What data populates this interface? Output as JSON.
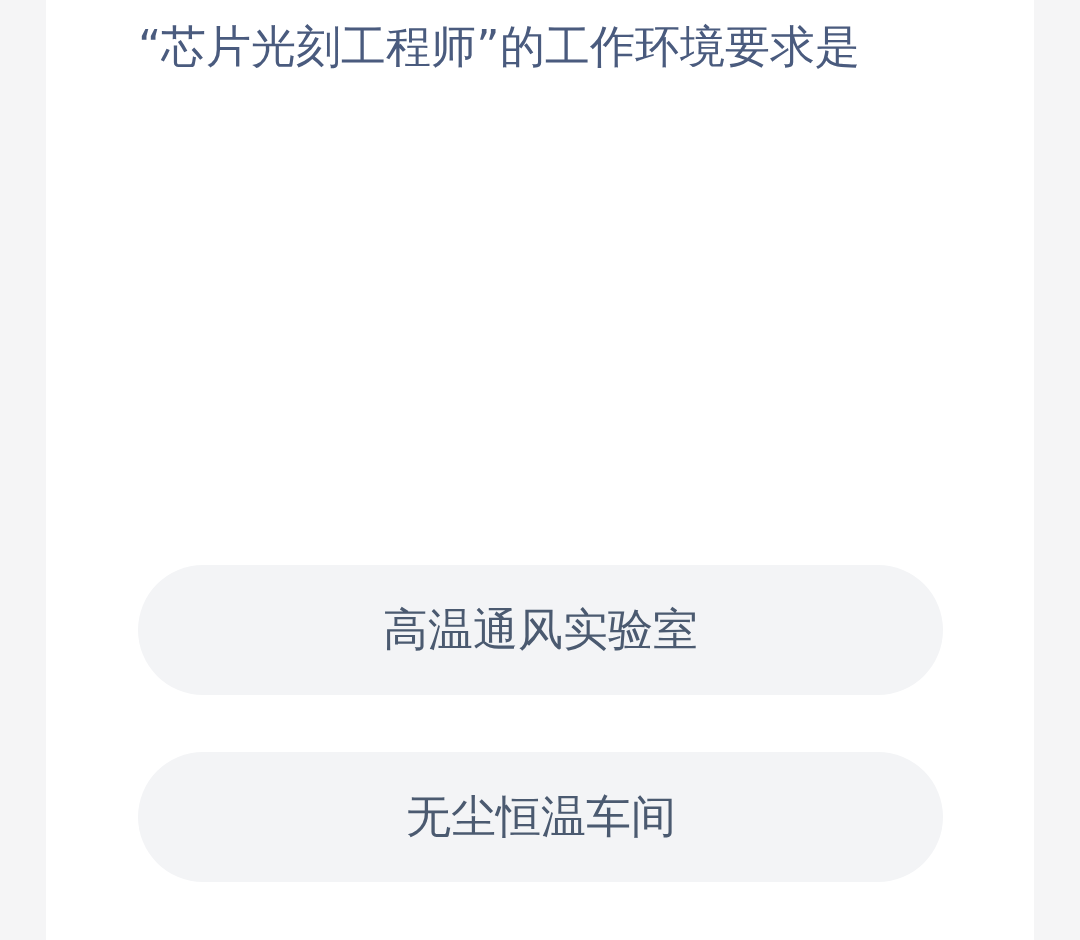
{
  "question": "“芯片光刻工程师”的工作环境要求是",
  "options": [
    {
      "label": "高温通风实验室"
    },
    {
      "label": "无尘恒温车间"
    }
  ]
}
